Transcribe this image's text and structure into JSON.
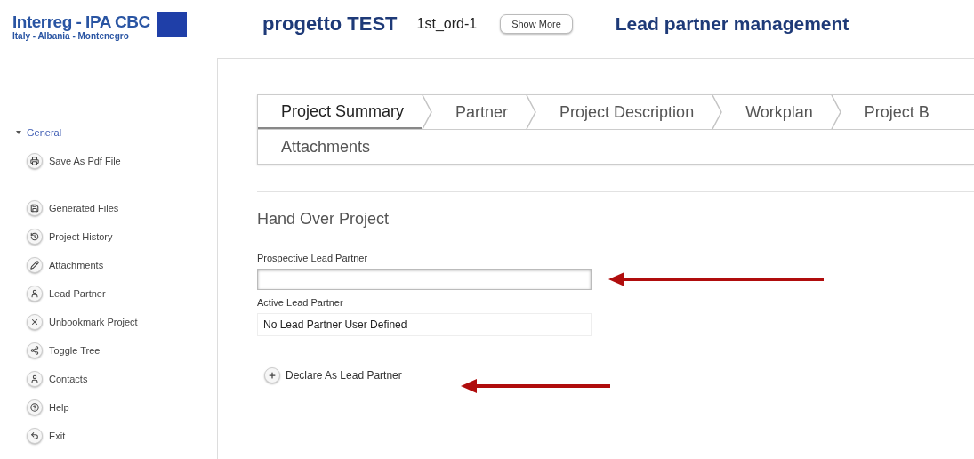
{
  "header": {
    "logo_title": "Interreg - IPA CBC",
    "logo_subtitle": "Italy - Albania - Montenegro",
    "project_name": "progetto TEST",
    "project_code": "1st_ord-1",
    "show_more_button": "Show More",
    "page_title": "Lead partner management"
  },
  "sidebar": {
    "section": {
      "label": "General",
      "expanded": true
    },
    "items": [
      {
        "label": "Save As Pdf File",
        "kind": "item"
      },
      {
        "kind": "separator"
      },
      {
        "label": "Generated Files",
        "kind": "item"
      },
      {
        "label": "Project History",
        "kind": "item"
      },
      {
        "label": "Attachments",
        "kind": "item"
      },
      {
        "label": "Lead Partner",
        "kind": "item"
      },
      {
        "label": "Unbookmark Project",
        "kind": "item"
      },
      {
        "label": "Toggle Tree",
        "kind": "item"
      },
      {
        "label": "Contacts",
        "kind": "item"
      },
      {
        "label": "Help",
        "kind": "item"
      },
      {
        "label": "Exit",
        "kind": "item"
      }
    ]
  },
  "tabs": [
    {
      "label": "Project Summary",
      "selected": true
    },
    {
      "label": "Partner",
      "selected": false
    },
    {
      "label": "Project Description",
      "selected": false
    },
    {
      "label": "Workplan",
      "selected": false
    },
    {
      "label": "Project B",
      "selected": false
    },
    {
      "label": "Attachments",
      "selected": false
    }
  ],
  "form": {
    "title": "Hand Over Project",
    "prospective_label": "Prospective Lead Partner",
    "active_label": "Active Lead Partner",
    "active_value": "No Lead Partner User Defined",
    "declare_button": "Declare As Lead Partner"
  }
}
